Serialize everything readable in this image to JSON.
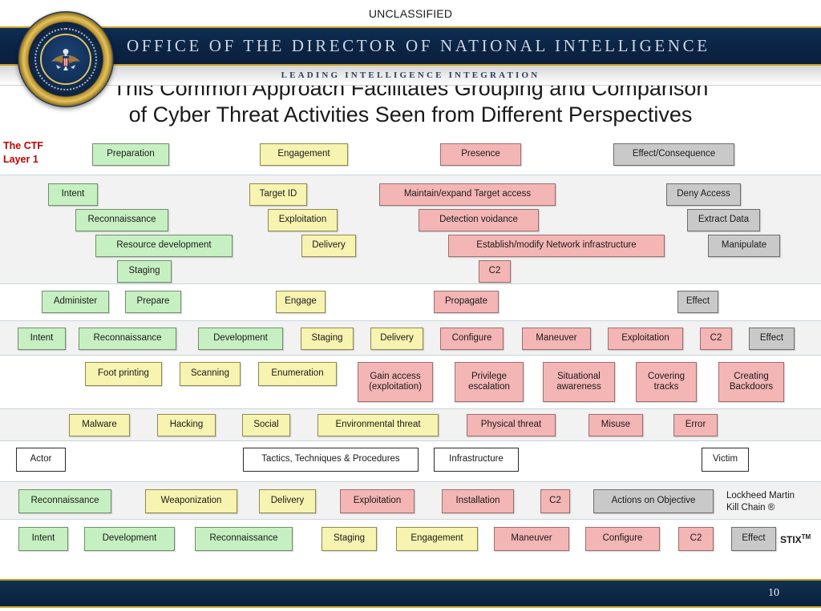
{
  "classification": "UNCLASSIFIED",
  "header": {
    "org_title": "OFFICE OF THE DIRECTOR OF NATIONAL INTELLIGENCE",
    "tagline": "LEADING INTELLIGENCE INTEGRATION",
    "seal_name": "odni-seal"
  },
  "slide": {
    "title_line1": "This Common Approach Facilitates Grouping and Comparison",
    "title_line2": "of Cyber Threat Activities Seen from Different Perspectives",
    "page_number": "10"
  },
  "ctf_label": {
    "line1": "The CTF",
    "line2": "Layer 1",
    "color": "#c00000"
  },
  "colors": {
    "green": "#c7f0c2",
    "yellow": "#f7f3b0",
    "pink": "#f4b5b5",
    "gray": "#c9c9c9",
    "white": "#ffffff",
    "navy": "#0b2445",
    "gold": "#c9a227",
    "band_shade": "#f2f2f2"
  },
  "rows": [
    {
      "id": "ctf-layer-1",
      "background": "plain",
      "boxes": [
        {
          "label": "Preparation",
          "color": "green"
        },
        {
          "label": "Engagement",
          "color": "yellow"
        },
        {
          "label": "Presence",
          "color": "pink"
        },
        {
          "label": "Effect/Consequence",
          "color": "gray"
        }
      ]
    },
    {
      "id": "ctf-layer-2",
      "background": "shade",
      "boxes": [
        {
          "label": "Intent",
          "color": "green"
        },
        {
          "label": "Reconnaissance",
          "color": "green"
        },
        {
          "label": "Resource development",
          "color": "green"
        },
        {
          "label": "Staging",
          "color": "green"
        },
        {
          "label": "Target ID",
          "color": "yellow"
        },
        {
          "label": "Exploitation",
          "color": "yellow"
        },
        {
          "label": "Delivery",
          "color": "yellow"
        },
        {
          "label": "Maintain/expand Target access",
          "color": "pink"
        },
        {
          "label": "Detection voidance",
          "color": "pink"
        },
        {
          "label": "Establish/modify Network infrastructure",
          "color": "pink"
        },
        {
          "label": "C2",
          "color": "pink"
        },
        {
          "label": "Deny Access",
          "color": "gray"
        },
        {
          "label": "Extract Data",
          "color": "gray"
        },
        {
          "label": "Manipulate",
          "color": "gray"
        }
      ]
    },
    {
      "id": "administer-row",
      "background": "plain",
      "boxes": [
        {
          "label": "Administer",
          "color": "green"
        },
        {
          "label": "Prepare",
          "color": "green"
        },
        {
          "label": "Engage",
          "color": "yellow"
        },
        {
          "label": "Propagate",
          "color": "pink"
        },
        {
          "label": "Effect",
          "color": "gray"
        }
      ]
    },
    {
      "id": "intent-effect-row",
      "background": "shade",
      "boxes": [
        {
          "label": "Intent",
          "color": "green"
        },
        {
          "label": "Reconnaissance",
          "color": "green"
        },
        {
          "label": "Development",
          "color": "green"
        },
        {
          "label": "Staging",
          "color": "yellow"
        },
        {
          "label": "Delivery",
          "color": "yellow"
        },
        {
          "label": "Configure",
          "color": "pink"
        },
        {
          "label": "Maneuver",
          "color": "pink"
        },
        {
          "label": "Exploitation",
          "color": "pink"
        },
        {
          "label": "C2",
          "color": "pink"
        },
        {
          "label": "Effect",
          "color": "gray"
        }
      ]
    },
    {
      "id": "attack-methodology-row",
      "background": "plain",
      "boxes": [
        {
          "label": "Foot printing",
          "color": "yellow"
        },
        {
          "label": "Scanning",
          "color": "yellow"
        },
        {
          "label": "Enumeration",
          "color": "yellow"
        },
        {
          "label": "Gain access (exploitation)",
          "color": "pink"
        },
        {
          "label": "Privilege escalation",
          "color": "pink"
        },
        {
          "label": "Situational awareness",
          "color": "pink"
        },
        {
          "label": "Covering tracks",
          "color": "pink"
        },
        {
          "label": "Creating Backdoors",
          "color": "pink"
        }
      ]
    },
    {
      "id": "threat-action-row",
      "background": "shade",
      "boxes": [
        {
          "label": "Malware",
          "color": "yellow"
        },
        {
          "label": "Hacking",
          "color": "yellow"
        },
        {
          "label": "Social",
          "color": "yellow"
        },
        {
          "label": "Environmental threat",
          "color": "yellow"
        },
        {
          "label": "Physical threat",
          "color": "pink"
        },
        {
          "label": "Misuse",
          "color": "pink"
        },
        {
          "label": "Error",
          "color": "pink"
        }
      ]
    },
    {
      "id": "actor-ttp-row",
      "background": "plain",
      "boxes": [
        {
          "label": "Actor",
          "color": "white"
        },
        {
          "label": "Tactics, Techniques & Procedures",
          "color": "white"
        },
        {
          "label": "Infrastructure",
          "color": "white"
        },
        {
          "label": "Victim",
          "color": "white"
        }
      ]
    },
    {
      "id": "kill-chain-row",
      "background": "shade",
      "note_line1": "Lockheed Martin",
      "note_line2": "Kill Chain ®",
      "boxes": [
        {
          "label": "Reconnaissance",
          "color": "green"
        },
        {
          "label": "Weaponization",
          "color": "yellow"
        },
        {
          "label": "Delivery",
          "color": "yellow"
        },
        {
          "label": "Exploitation",
          "color": "pink"
        },
        {
          "label": "Installation",
          "color": "pink"
        },
        {
          "label": "C2",
          "color": "pink"
        },
        {
          "label": "Actions on Objective",
          "color": "gray"
        }
      ]
    },
    {
      "id": "stix-row",
      "background": "plain",
      "note": "STIX",
      "note_sup": "TM",
      "boxes": [
        {
          "label": "Intent",
          "color": "green"
        },
        {
          "label": "Development",
          "color": "green"
        },
        {
          "label": "Reconnaissance",
          "color": "green"
        },
        {
          "label": "Staging",
          "color": "yellow"
        },
        {
          "label": "Engagement",
          "color": "yellow"
        },
        {
          "label": "Maneuver",
          "color": "pink"
        },
        {
          "label": "Configure",
          "color": "pink"
        },
        {
          "label": "C2",
          "color": "pink"
        },
        {
          "label": "Effect",
          "color": "gray"
        }
      ]
    }
  ]
}
